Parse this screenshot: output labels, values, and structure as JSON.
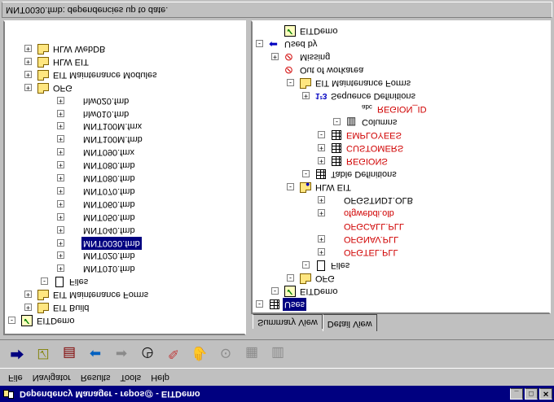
{
  "window": {
    "title": "Dependency Manager - repos@ - EITDemo",
    "buttons": [
      "_",
      "□",
      "✕"
    ]
  },
  "menu": [
    "File",
    "Navigator",
    "Results",
    "Tools",
    "Help"
  ],
  "toolbar": [
    {
      "name": "connect-icon",
      "glyph": "⮕",
      "enabled": true,
      "color": "#000080"
    },
    {
      "name": "check-icon",
      "glyph": "☑",
      "enabled": true,
      "color": "#808000"
    },
    {
      "name": "report-icon",
      "glyph": "▤",
      "enabled": true,
      "color": "#800000"
    },
    {
      "name": "back-icon",
      "glyph": "⬅",
      "enabled": true,
      "color": "#0060c0"
    },
    {
      "name": "forward-icon",
      "glyph": "➡",
      "enabled": false,
      "color": "#8a8a8a"
    },
    {
      "name": "stopwatch-icon",
      "glyph": "◷",
      "enabled": true,
      "color": "#000000"
    },
    {
      "name": "eraser-icon",
      "glyph": "✎",
      "enabled": true,
      "color": "#c04040"
    },
    {
      "name": "hand-icon",
      "glyph": "✋",
      "enabled": false,
      "color": "#8a8a8a"
    },
    {
      "name": "search-icon",
      "glyph": "⊙",
      "enabled": false,
      "color": "#8a8a8a"
    },
    {
      "name": "table-icon",
      "glyph": "▦",
      "enabled": false,
      "color": "#8a8a8a"
    },
    {
      "name": "columns-icon",
      "glyph": "▥",
      "enabled": false,
      "color": "#8a8a8a"
    }
  ],
  "tabs": [
    "Summary View",
    "Detail View"
  ],
  "status": "MNT0030.fmb: dependencies up to date.",
  "left_tree": [
    {
      "label": "EITDemo",
      "icon": "check",
      "expander": "-",
      "level": 0
    },
    {
      "label": "EIT Build",
      "icon": "folder",
      "expander": "+",
      "level": 1
    },
    {
      "label": "EIT Maintenance Forms",
      "icon": "folder",
      "expander": "+",
      "level": 1
    },
    {
      "label": "Files",
      "icon": "file",
      "expander": "-",
      "level": 2
    },
    {
      "label": "MNT010.fmb",
      "icon": "",
      "expander": "+",
      "level": 3
    },
    {
      "label": "MNT020.fmb",
      "icon": "",
      "expander": "+",
      "level": 3
    },
    {
      "label": "MNT0030.fmb",
      "icon": "",
      "expander": "+",
      "level": 3,
      "selected": true
    },
    {
      "label": "MNT040.fmb",
      "icon": "",
      "expander": "+",
      "level": 3
    },
    {
      "label": "MNT050.fmb",
      "icon": "",
      "expander": "+",
      "level": 3
    },
    {
      "label": "MNT060.fmb",
      "icon": "",
      "expander": "+",
      "level": 3
    },
    {
      "label": "MNT070.fmb",
      "icon": "",
      "expander": "+",
      "level": 3
    },
    {
      "label": "MNT080.fmb",
      "icon": "",
      "expander": "+",
      "level": 3
    },
    {
      "label": "MNT080.fmb",
      "icon": "",
      "expander": "+",
      "level": 3
    },
    {
      "label": "MNT090.fmx",
      "icon": "",
      "expander": "+",
      "level": 3
    },
    {
      "label": "MNT100M.fmb",
      "icon": "",
      "expander": "+",
      "level": 3
    },
    {
      "label": "MNT100M.fmx",
      "icon": "",
      "expander": "+",
      "level": 3
    },
    {
      "label": "hlw010.fmb",
      "icon": "",
      "expander": "+",
      "level": 3
    },
    {
      "label": "hlw020.fmb",
      "icon": "",
      "expander": "+",
      "level": 3
    },
    {
      "label": "OFG",
      "icon": "folder",
      "expander": "+",
      "level": 1
    },
    {
      "label": "EIT Maintenance Modules",
      "icon": "folder",
      "expander": "+",
      "level": 1
    },
    {
      "label": "HLW EIT",
      "icon": "folder",
      "expander": "+",
      "level": 1
    },
    {
      "label": "HLW WebDB",
      "icon": "folder",
      "expander": "+",
      "level": 1
    }
  ],
  "right_tree": [
    {
      "label": "Uses",
      "icon": "list",
      "expander": "-",
      "level": 0,
      "selected": true
    },
    {
      "label": "EITDemo",
      "icon": "check",
      "expander": "-",
      "level": 1
    },
    {
      "label": "OFG",
      "icon": "folder",
      "expander": "-",
      "level": 2
    },
    {
      "label": "Files",
      "icon": "file",
      "expander": "-",
      "level": 3
    },
    {
      "label": "OFGTEL.PLL",
      "icon": "",
      "expander": "+",
      "level": 4,
      "red": true
    },
    {
      "label": "OFGNAV.PLL",
      "icon": "",
      "expander": "+",
      "level": 4,
      "red": true
    },
    {
      "label": "OFGCALL.PLL",
      "icon": "",
      "expander": "",
      "level": 4,
      "red": true
    },
    {
      "label": "ofgwebdi.olb",
      "icon": "",
      "expander": "+",
      "level": 4,
      "red": true
    },
    {
      "label": "OFGSTND1.OLB",
      "icon": "",
      "expander": "+",
      "level": 4
    },
    {
      "label": "HLW EIT",
      "icon": "folderglobe",
      "expander": "-",
      "level": 2
    },
    {
      "label": "Table Definitions",
      "icon": "grid",
      "expander": "-",
      "level": 3
    },
    {
      "label": "REGIONS",
      "icon": "grid",
      "expander": "+",
      "level": 4,
      "red": true
    },
    {
      "label": "CUSTOMERS",
      "icon": "grid",
      "expander": "+",
      "level": 4,
      "red": true
    },
    {
      "label": "EMPLOYEES",
      "icon": "grid",
      "expander": "-",
      "level": 4,
      "red": true
    },
    {
      "label": "Columns",
      "icon": "columns",
      "expander": "-",
      "level": 5
    },
    {
      "label": "REGION_ID",
      "icon": "abc",
      "expander": "",
      "level": 6,
      "red": true
    },
    {
      "label": "Sequence Definitions",
      "icon": "seq",
      "expander": "+",
      "level": 3
    },
    {
      "label": "EIT Maintenance Forms",
      "icon": "folder",
      "expander": "-",
      "level": 2
    },
    {
      "label": "Out of workarea",
      "icon": "outof",
      "expander": "",
      "level": 1
    },
    {
      "label": "Missing",
      "icon": "missing",
      "expander": "+",
      "level": 1
    },
    {
      "label": "Used by",
      "icon": "usedby",
      "expander": "-",
      "level": 0
    },
    {
      "label": "EITDemo",
      "icon": "check",
      "expander": "",
      "level": 1
    }
  ]
}
